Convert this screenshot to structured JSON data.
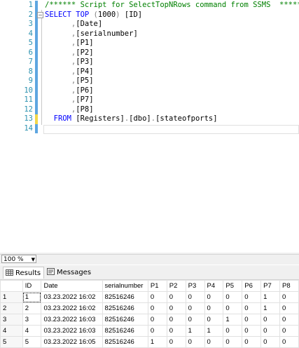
{
  "editor": {
    "lines": [
      {
        "num": "1",
        "segments": [
          {
            "t": "/****** Script for SelectTopNRows command from SSMS  ******/",
            "c": "cm"
          }
        ]
      },
      {
        "num": "2",
        "segments": [
          {
            "t": "SELECT TOP ",
            "c": "kw"
          },
          {
            "t": "(",
            "c": "gr"
          },
          {
            "t": "1000",
            "c": ""
          },
          {
            "t": ")",
            "c": "gr"
          },
          {
            "t": " [ID]",
            "c": ""
          }
        ]
      },
      {
        "num": "3",
        "segments": [
          {
            "t": "      ,",
            "c": "gr"
          },
          {
            "t": "[Date]",
            "c": ""
          }
        ]
      },
      {
        "num": "4",
        "segments": [
          {
            "t": "      ,",
            "c": "gr"
          },
          {
            "t": "[serialnumber]",
            "c": ""
          }
        ]
      },
      {
        "num": "5",
        "segments": [
          {
            "t": "      ,",
            "c": "gr"
          },
          {
            "t": "[P1]",
            "c": ""
          }
        ]
      },
      {
        "num": "6",
        "segments": [
          {
            "t": "      ,",
            "c": "gr"
          },
          {
            "t": "[P2]",
            "c": ""
          }
        ]
      },
      {
        "num": "7",
        "segments": [
          {
            "t": "      ,",
            "c": "gr"
          },
          {
            "t": "[P3]",
            "c": ""
          }
        ]
      },
      {
        "num": "8",
        "segments": [
          {
            "t": "      ,",
            "c": "gr"
          },
          {
            "t": "[P4]",
            "c": ""
          }
        ]
      },
      {
        "num": "9",
        "segments": [
          {
            "t": "      ,",
            "c": "gr"
          },
          {
            "t": "[P5]",
            "c": ""
          }
        ]
      },
      {
        "num": "10",
        "segments": [
          {
            "t": "      ,",
            "c": "gr"
          },
          {
            "t": "[P6]",
            "c": ""
          }
        ]
      },
      {
        "num": "11",
        "segments": [
          {
            "t": "      ,",
            "c": "gr"
          },
          {
            "t": "[P7]",
            "c": ""
          }
        ]
      },
      {
        "num": "12",
        "segments": [
          {
            "t": "      ,",
            "c": "gr"
          },
          {
            "t": "[P8]",
            "c": ""
          }
        ]
      },
      {
        "num": "13",
        "segments": [
          {
            "t": "  FROM ",
            "c": "kw"
          },
          {
            "t": "[Registers]",
            "c": ""
          },
          {
            "t": ".",
            "c": "gr"
          },
          {
            "t": "[dbo]",
            "c": ""
          },
          {
            "t": ".",
            "c": "gr"
          },
          {
            "t": "[stateofports]",
            "c": ""
          }
        ]
      },
      {
        "num": "14",
        "segments": []
      }
    ]
  },
  "zoom": {
    "value": "100 %"
  },
  "tabs": [
    {
      "label": "Results",
      "icon": "grid-icon",
      "active": true
    },
    {
      "label": "Messages",
      "icon": "messages-icon",
      "active": false
    }
  ],
  "results": {
    "columns": [
      "",
      "ID",
      "Date",
      "serialnumber",
      "P1",
      "P2",
      "P3",
      "P4",
      "P5",
      "P6",
      "P7",
      "P8"
    ],
    "rows": [
      [
        "1",
        "1",
        "03.23.2022 16:02",
        "82516246",
        "0",
        "0",
        "0",
        "0",
        "0",
        "0",
        "1",
        "0"
      ],
      [
        "2",
        "2",
        "03.23.2022 16:02",
        "82516246",
        "0",
        "0",
        "0",
        "0",
        "0",
        "0",
        "1",
        "0"
      ],
      [
        "3",
        "3",
        "03.23.2022 16:03",
        "82516246",
        "0",
        "0",
        "0",
        "0",
        "1",
        "0",
        "0",
        "0"
      ],
      [
        "4",
        "4",
        "03.23.2022 16:03",
        "82516246",
        "0",
        "0",
        "1",
        "1",
        "0",
        "0",
        "0",
        "0"
      ],
      [
        "5",
        "5",
        "03.23.2022 16:05",
        "82516246",
        "1",
        "0",
        "0",
        "0",
        "0",
        "0",
        "0",
        "0"
      ]
    ]
  },
  "colors": {
    "keyword": "#0000ff",
    "comment": "#008000",
    "linenumber": "#2b91af",
    "changemark_saved": "#5ea6e0",
    "changemark_unsaved": "#f2d74a"
  }
}
